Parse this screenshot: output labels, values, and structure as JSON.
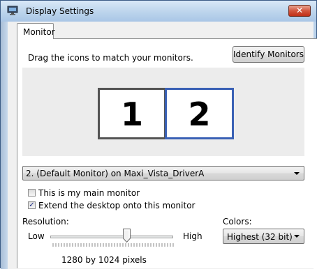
{
  "window": {
    "title": "Display Settings",
    "close_label": "✕"
  },
  "tabs": [
    {
      "label": "Monitor",
      "selected": true
    }
  ],
  "instruction": "Drag the icons to match your monitors.",
  "identify_button": "Identify Monitors",
  "monitors": [
    {
      "number": "1",
      "selected": false
    },
    {
      "number": "2",
      "selected": true
    }
  ],
  "monitor_select": {
    "value": "2. (Default Monitor) on Maxi_Vista_DriverA"
  },
  "checkboxes": {
    "main_monitor": {
      "label": "This is my main monitor",
      "checked": false,
      "mark": ""
    },
    "extend_desktop": {
      "label": "Extend the desktop onto this monitor",
      "checked": true,
      "mark": "✓"
    }
  },
  "resolution": {
    "label": "Resolution:",
    "low": "Low",
    "high": "High",
    "value": "1280 by 1024 pixels",
    "slider_position": 0.62
  },
  "colors": {
    "label": "Colors:",
    "value": "Highest (32 bit)"
  },
  "palette": {
    "selected_monitor_border": "#3a61b5",
    "monitor_border": "#545454",
    "titlebar": "#bcd4ec"
  }
}
